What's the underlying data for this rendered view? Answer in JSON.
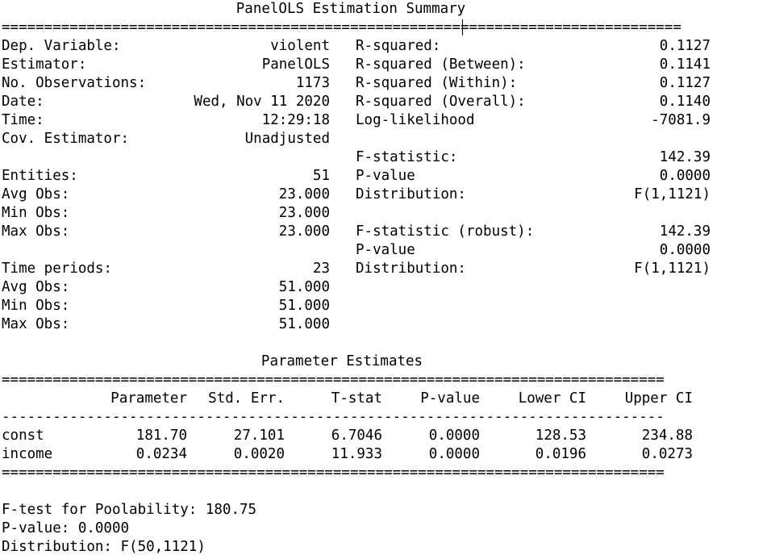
{
  "summary": {
    "title": "PanelOLS Estimation Summary",
    "left_rows": [
      {
        "label": "Dep. Variable:",
        "value": "violent"
      },
      {
        "label": "Estimator:",
        "value": "PanelOLS"
      },
      {
        "label": "No. Observations:",
        "value": "1173"
      },
      {
        "label": "Date:",
        "value": "Wed, Nov 11 2020"
      },
      {
        "label": "Time:",
        "value": "12:29:18"
      },
      {
        "label": "Cov. Estimator:",
        "value": "Unadjusted"
      },
      {
        "label": "",
        "value": ""
      },
      {
        "label": "Entities:",
        "value": "51"
      },
      {
        "label": "Avg Obs:",
        "value": "23.000"
      },
      {
        "label": "Min Obs:",
        "value": "23.000"
      },
      {
        "label": "Max Obs:",
        "value": "23.000"
      },
      {
        "label": "",
        "value": ""
      },
      {
        "label": "Time periods:",
        "value": "23"
      },
      {
        "label": "Avg Obs:",
        "value": "51.000"
      },
      {
        "label": "Min Obs:",
        "value": "51.000"
      },
      {
        "label": "Max Obs:",
        "value": "51.000"
      }
    ],
    "right_rows": [
      {
        "label": "R-squared:",
        "value": "0.1127"
      },
      {
        "label": "R-squared (Between):",
        "value": "0.1141"
      },
      {
        "label": "R-squared (Within):",
        "value": "0.1127"
      },
      {
        "label": "R-squared (Overall):",
        "value": "0.1140"
      },
      {
        "label": "Log-likelihood",
        "value": "-7081.9"
      },
      {
        "label": "",
        "value": ""
      },
      {
        "label": "F-statistic:",
        "value": "142.39"
      },
      {
        "label": "P-value",
        "value": "0.0000"
      },
      {
        "label": "Distribution:",
        "value": "F(1,1121)"
      },
      {
        "label": "",
        "value": ""
      },
      {
        "label": "F-statistic (robust):",
        "value": "142.39"
      },
      {
        "label": "P-value",
        "value": "0.0000"
      },
      {
        "label": "Distribution:",
        "value": "F(1,1121)"
      }
    ]
  },
  "estimates": {
    "title": "Parameter Estimates",
    "columns": [
      "Parameter",
      "Std. Err.",
      "T-stat",
      "P-value",
      "Lower CI",
      "Upper CI"
    ],
    "rows": [
      {
        "name": "const",
        "values": [
          "181.70",
          "27.101",
          "6.7046",
          "0.0000",
          "128.53",
          "234.88"
        ]
      },
      {
        "name": "income",
        "values": [
          "0.0234",
          "0.0020",
          "11.933",
          "0.0000",
          "0.0196",
          "0.0273"
        ]
      }
    ]
  },
  "footer": {
    "lines": [
      "F-test for Poolability: 180.75",
      "P-value: 0.0000",
      "Distribution: F(50,1121)"
    ]
  }
}
